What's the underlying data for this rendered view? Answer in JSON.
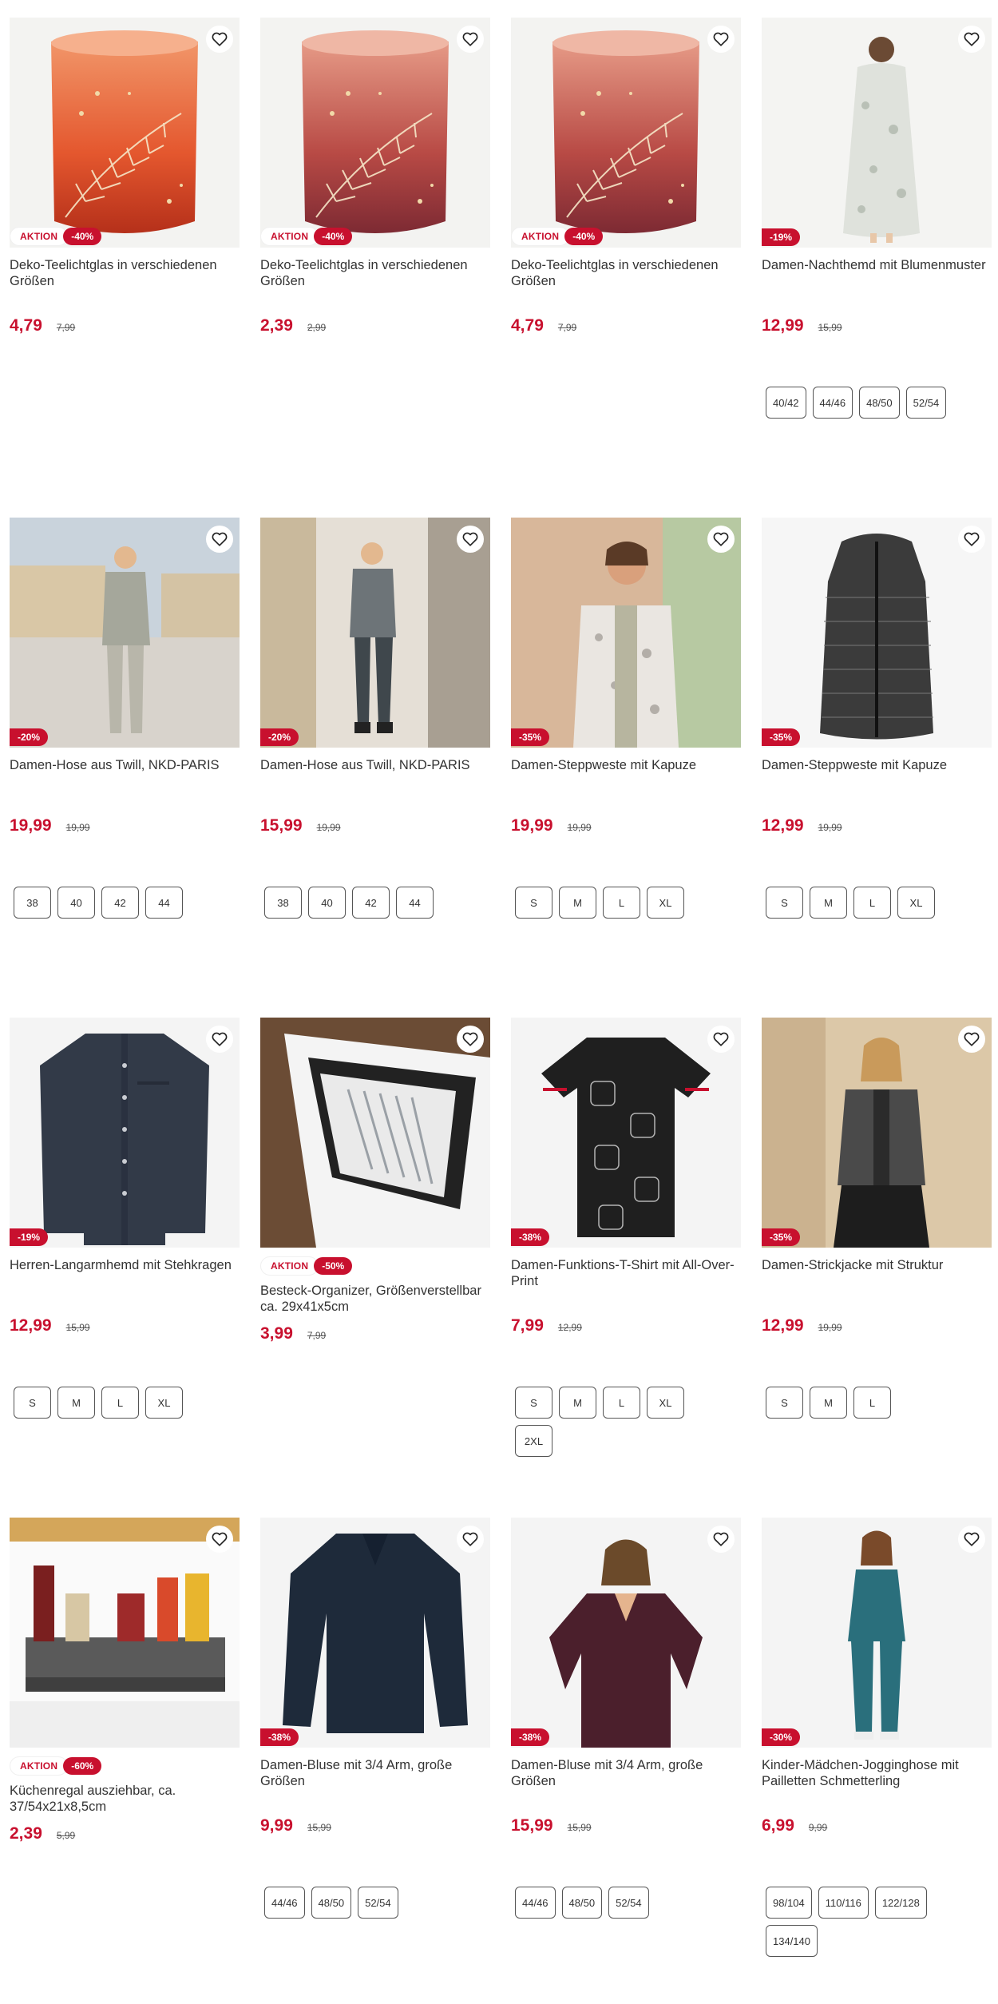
{
  "colors": {
    "accent": "#c8102e",
    "text": "#333333",
    "image_bg": "#f3f3f1"
  },
  "products": [
    {
      "title": "Deko-Teelichtglas in verschiedenen Größen",
      "price": "4,79",
      "old_price": "7,99",
      "aktion": "AKTION",
      "discount": "-40%",
      "image": "candle-glass-orange",
      "sizes": []
    },
    {
      "title": "Deko-Teelichtglas in verschiedenen Größen",
      "price": "2,39",
      "old_price": "2,99",
      "aktion": "AKTION",
      "discount": "-40%",
      "image": "candle-glass-rose",
      "sizes": []
    },
    {
      "title": "Deko-Teelichtglas in verschiedenen Größen",
      "price": "4,79",
      "old_price": "7,99",
      "aktion": "AKTION",
      "discount": "-40%",
      "image": "candle-glass-rose",
      "sizes": []
    },
    {
      "title": "Damen-Nachthemd mit Blumenmuster",
      "price": "12,99",
      "old_price": "15,99",
      "aktion": "",
      "discount": "-19%",
      "image": "nightdress",
      "sizes": [
        "40/42",
        "44/46",
        "48/50",
        "52/54"
      ]
    },
    {
      "title": "Damen-Hose aus Twill, NKD-PARIS",
      "price": "19,99",
      "old_price": "19,99",
      "aktion": "",
      "discount": "-20%",
      "image": "woman-grey-outfit",
      "sizes": [
        "38",
        "40",
        "42",
        "44"
      ]
    },
    {
      "title": "Damen-Hose aus Twill, NKD-PARIS",
      "price": "15,99",
      "old_price": "19,99",
      "aktion": "",
      "discount": "-20%",
      "image": "woman-dark-jeans",
      "sizes": [
        "38",
        "40",
        "42",
        "44"
      ]
    },
    {
      "title": "Damen-Steppweste mit Kapuze",
      "price": "19,99",
      "old_price": "19,99",
      "aktion": "",
      "discount": "-35%",
      "image": "woman-vest",
      "sizes": [
        "S",
        "M",
        "L",
        "XL"
      ]
    },
    {
      "title": "Damen-Steppweste mit Kapuze",
      "price": "12,99",
      "old_price": "19,99",
      "aktion": "",
      "discount": "-35%",
      "image": "vest-black",
      "sizes": [
        "S",
        "M",
        "L",
        "XL"
      ]
    },
    {
      "title": "Herren-Langarmhemd mit Stehkragen",
      "price": "12,99",
      "old_price": "15,99",
      "aktion": "",
      "discount": "-19%",
      "image": "shirt-navy",
      "sizes": [
        "S",
        "M",
        "L",
        "XL"
      ]
    },
    {
      "title": "Besteck-Organizer, Größenverstellbar ca. 29x41x5cm",
      "price": "3,99",
      "old_price": "7,99",
      "aktion": "AKTION",
      "discount": "-50%",
      "image": "cutlery-organizer",
      "sizes": [],
      "compact": true
    },
    {
      "title": "Damen-Funktions-T-Shirt mit All-Over-Print",
      "price": "7,99",
      "old_price": "12,99",
      "aktion": "",
      "discount": "-38%",
      "image": "tshirt-black",
      "sizes": [
        "S",
        "M",
        "L",
        "XL",
        "2XL"
      ]
    },
    {
      "title": "Damen-Strickjacke mit Struktur",
      "price": "12,99",
      "old_price": "19,99",
      "aktion": "",
      "discount": "-35%",
      "image": "woman-cardigan",
      "sizes": [
        "S",
        "M",
        "L"
      ]
    },
    {
      "title": "Küchenregal ausziehbar, ca. 37/54x21x8,5cm",
      "price": "2,39",
      "old_price": "5,99",
      "aktion": "AKTION",
      "discount": "-60%",
      "image": "kitchen-shelf",
      "sizes": [],
      "compact": true
    },
    {
      "title": "Damen-Bluse mit 3/4 Arm, große Größen",
      "price": "9,99",
      "old_price": "15,99",
      "aktion": "",
      "discount": "-38%",
      "image": "blouse-navy",
      "sizes": [
        "44/46",
        "48/50",
        "52/54"
      ]
    },
    {
      "title": "Damen-Bluse mit 3/4 Arm, große Größen",
      "price": "15,99",
      "old_price": "15,99",
      "aktion": "",
      "discount": "-38%",
      "image": "woman-blouse-plum",
      "sizes": [
        "44/46",
        "48/50",
        "52/54"
      ]
    },
    {
      "title": "Kinder-Mädchen-Jogginghose mit Pailletten Schmetterling",
      "price": "6,99",
      "old_price": "9,99",
      "aktion": "",
      "discount": "-30%",
      "image": "girl-jogging",
      "sizes": [
        "98/104",
        "110/116",
        "122/128",
        "134/140"
      ]
    }
  ]
}
